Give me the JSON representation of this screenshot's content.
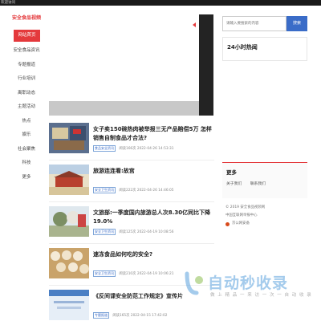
{
  "browser": {
    "title": "欢迎访问"
  },
  "sidebar": {
    "logo": "安全食品视频",
    "items": [
      {
        "label": "网站首页",
        "active": true
      },
      {
        "label": "安全食品资讯"
      },
      {
        "label": "专题报道"
      },
      {
        "label": "行业培训"
      },
      {
        "label": "离职动态"
      },
      {
        "label": "主题活动"
      },
      {
        "label": "热点"
      },
      {
        "label": "娱乐"
      },
      {
        "label": "社会聚焦"
      },
      {
        "label": "科技"
      },
      {
        "label": "更多"
      }
    ]
  },
  "banner": {
    "tab_label": ""
  },
  "search": {
    "placeholder": "请输入要搜索的内容",
    "button_label": "搜索"
  },
  "hot": {
    "title": "24小时热闻"
  },
  "articles": [
    {
      "title": "女子卖150碗热肉被举报三无产品赔偿5万 怎样销售自制食品才合法?",
      "tag": "食品安全资讯",
      "views": "阅读166次",
      "date": "2022-04-26 14:53:31"
    },
    {
      "title": "旅游连连看:故宫",
      "tag": "安全卫生资讯",
      "views": "阅读222次",
      "date": "2022-04-26 14:46:05"
    },
    {
      "title": "文旅部:一季度国内旅游总人次8.30亿同比下降19.0%",
      "tag": "安全卫生资讯",
      "views": "阅读125次",
      "date": "2022-04-19 10:08:56"
    },
    {
      "title": "速冻食品如何吃的安全?",
      "tag": "安全卫生资讯",
      "views": "阅读210次",
      "date": "2022-04-19 10:06:21"
    },
    {
      "title": "《反间谍安全防范工作规定》宣传片",
      "tag": "专题报道",
      "views": "阅读165次",
      "date": "2022-04-15 17:42:02"
    }
  ],
  "more": {
    "title": "更多",
    "links": [
      "关于我们",
      "联系我们"
    ]
  },
  "footer": {
    "copyright": "© 2019 安全食品视频网",
    "icp": "中国互联网举报中心",
    "police": "京公网安备"
  },
  "watermark": {
    "text": "自动秒收录",
    "sub": "做 上 精 品 一 来 访 一 次 一 自 动 收 录"
  }
}
